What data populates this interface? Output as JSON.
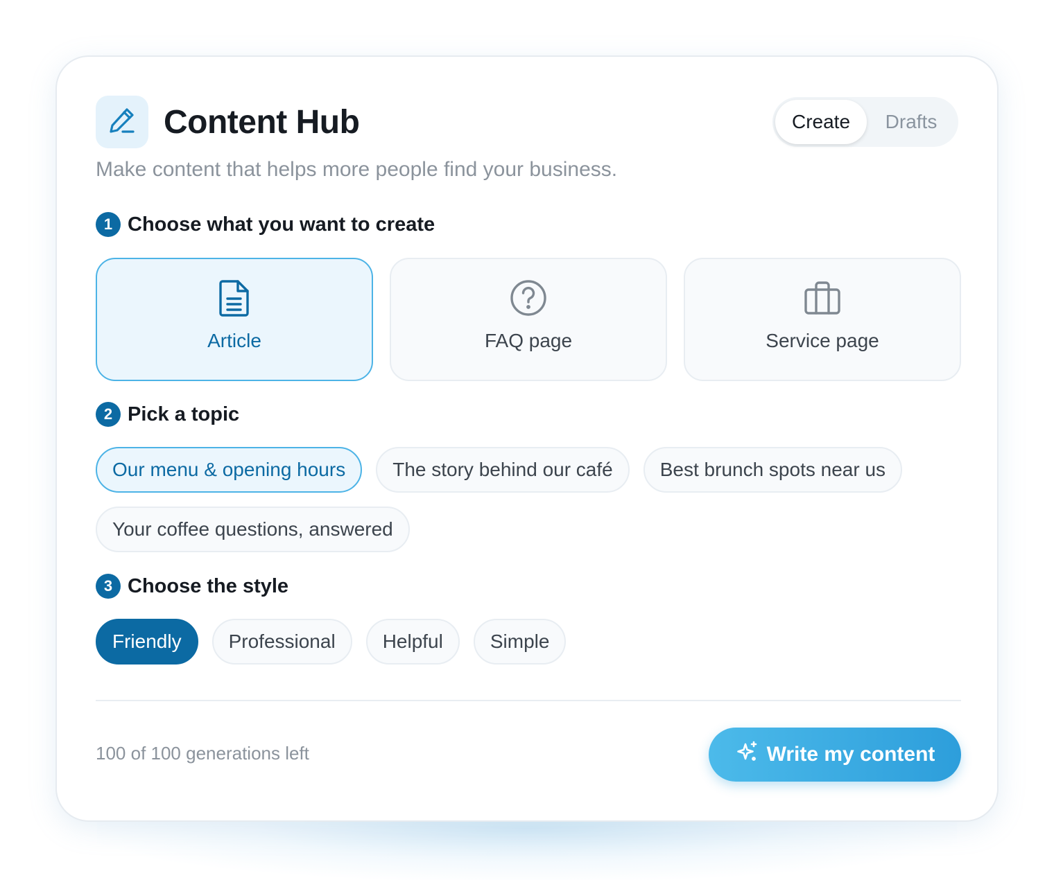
{
  "header": {
    "title": "Content Hub",
    "subtitle": "Make content that helps more people find your business.",
    "tabs": [
      {
        "label": "Create",
        "active": true
      },
      {
        "label": "Drafts",
        "active": false
      }
    ]
  },
  "steps": [
    {
      "number": "1",
      "label": "Choose what you want to create"
    },
    {
      "number": "2",
      "label": "Pick a topic"
    },
    {
      "number": "3",
      "label": "Choose the style"
    }
  ],
  "content_types": [
    {
      "label": "Article",
      "icon": "document-icon",
      "selected": true
    },
    {
      "label": "FAQ page",
      "icon": "question-circle-icon",
      "selected": false
    },
    {
      "label": "Service page",
      "icon": "briefcase-icon",
      "selected": false
    }
  ],
  "topics": [
    {
      "label": "Our menu & opening hours",
      "selected": true
    },
    {
      "label": "The story behind our café",
      "selected": false
    },
    {
      "label": "Best brunch spots near us",
      "selected": false
    },
    {
      "label": "Your coffee questions, answered",
      "selected": false
    }
  ],
  "styles": [
    {
      "label": "Friendly",
      "selected": true
    },
    {
      "label": "Professional",
      "selected": false
    },
    {
      "label": "Helpful",
      "selected": false
    },
    {
      "label": "Simple",
      "selected": false
    }
  ],
  "footer": {
    "quota": "100 of 100 generations left",
    "cta_label": "Write my content",
    "cta_icon": "sparkle-icon"
  },
  "colors": {
    "accent": "#0c6aa3",
    "accent_light": "#4cb3e6",
    "cta_gradient_start": "#4cbaea",
    "cta_gradient_end": "#2d9edb"
  }
}
